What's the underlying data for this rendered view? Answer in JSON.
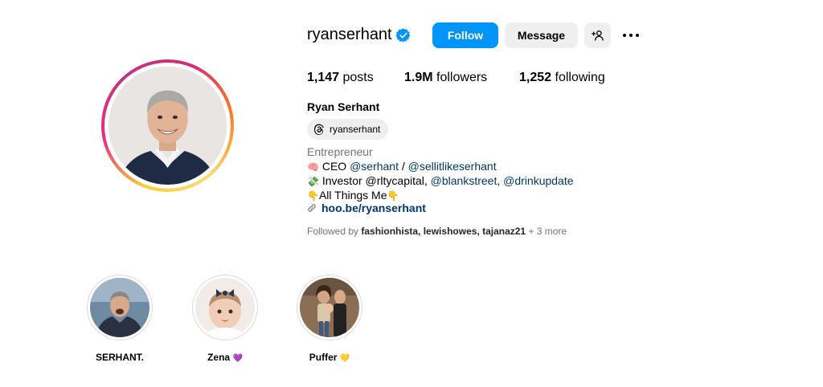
{
  "profile": {
    "username": "ryanserhant",
    "full_name": "Ryan Serhant",
    "follow_label": "Follow",
    "message_label": "Message",
    "threads_handle": "ryanserhant",
    "category": "Entrepreneur",
    "accent_color": "#0095f6",
    "link_color": "#00376b"
  },
  "stats": {
    "posts_count": "1,147",
    "posts_label": "posts",
    "followers_count": "1.9M",
    "followers_label": "followers",
    "following_count": "1,252",
    "following_label": "following"
  },
  "bio": {
    "line1_emoji": "🧠",
    "line1_prefix": "CEO ",
    "line1_mention1": "@serhant",
    "line1_sep": " / ",
    "line1_mention2": "@sellitlikeserhant",
    "line2_emoji": "💸",
    "line2_prefix": "Investor @rltycapital, ",
    "line2_mention1": "@blankstreet",
    "line2_sep": ", ",
    "line2_mention2": "@drinkupdate",
    "line3_emoji_left": "👇",
    "line3_text": "All Things Me",
    "line3_emoji_right": "👇",
    "link": "hoo.be/ryanserhant"
  },
  "followed_by": {
    "prefix": "Followed by ",
    "names": "fashionhista, lewishowes, tajanaz21",
    "suffix": " + 3 more"
  },
  "highlights": [
    {
      "label": "SERHANT.",
      "emoji": ""
    },
    {
      "label": "Zena",
      "emoji": "💜"
    },
    {
      "label": "Puffer",
      "emoji": "💛"
    }
  ],
  "icons": {
    "verified": "verified-badge-icon",
    "add_user": "add-user-icon",
    "more": "more-options-icon",
    "threads": "threads-icon",
    "link": "link-icon"
  }
}
